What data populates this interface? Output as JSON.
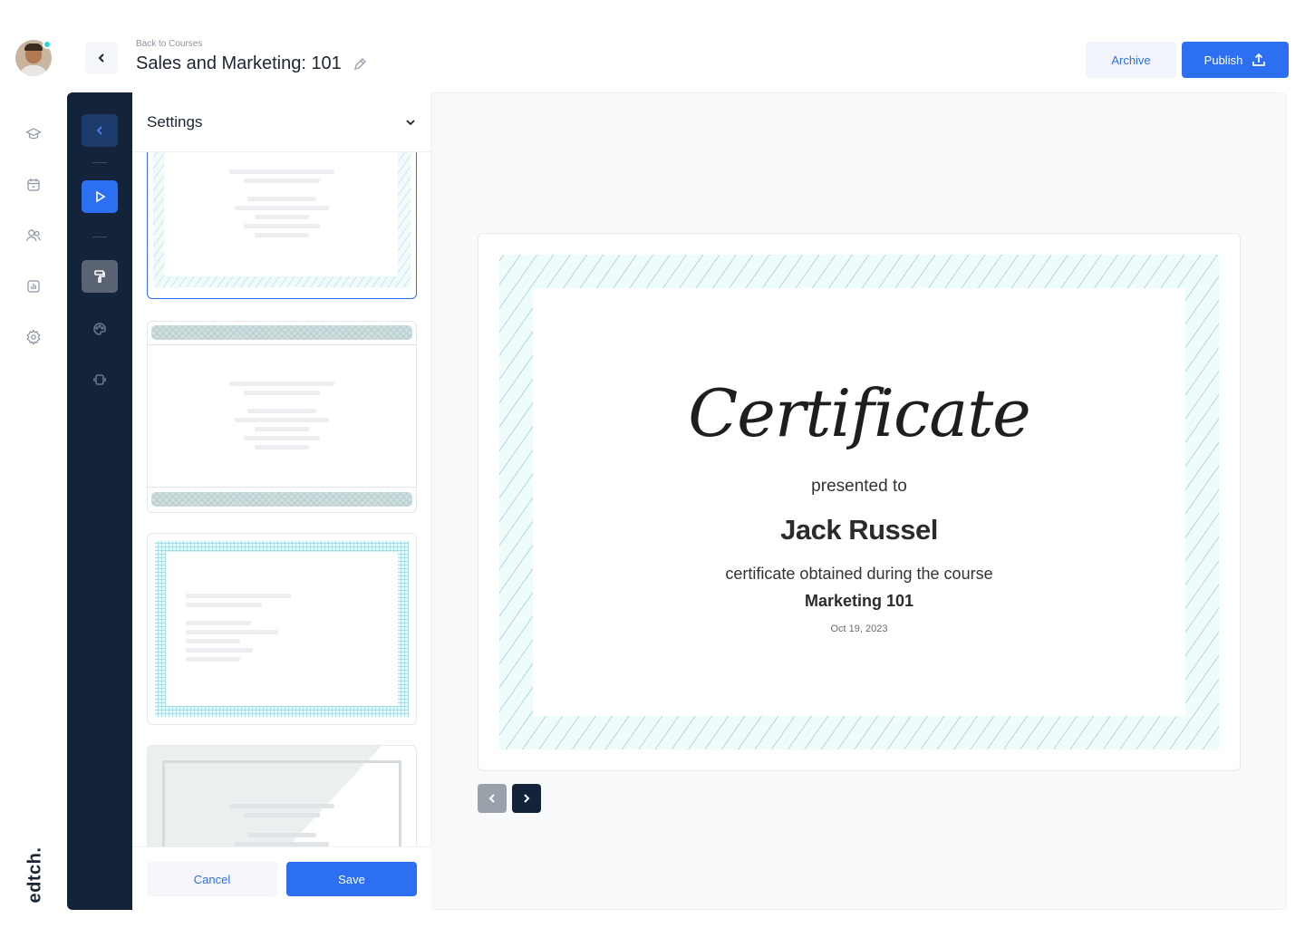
{
  "header": {
    "breadcrumb": "Back to Courses",
    "title": "Sales and Marketing: 101",
    "archive_label": "Archive",
    "publish_label": "Publish"
  },
  "brand": {
    "logo_text": "edtch."
  },
  "rail": {
    "icons": [
      "graduation-cap-icon",
      "calendar-icon",
      "users-icon",
      "chart-icon",
      "gear-icon"
    ]
  },
  "strip": {
    "icons": [
      "chevron-left-icon",
      "play-icon",
      "paint-roller-icon",
      "palette-icon",
      "rotate-icon"
    ]
  },
  "panel": {
    "title": "Settings",
    "cancel_label": "Cancel",
    "save_label": "Save"
  },
  "certificate": {
    "script_title": "Certificate",
    "presented_to": "presented to",
    "recipient": "Jack Russel",
    "obtained_text": "certificate obtained during the course",
    "course": "Marketing 101",
    "date": "Oct 19, 2023"
  },
  "colors": {
    "accent": "#2d6ff1",
    "sidebar_dark": "#13233a",
    "online_dot": "#2ed3d3",
    "frame_bg": "#eefcfc"
  }
}
